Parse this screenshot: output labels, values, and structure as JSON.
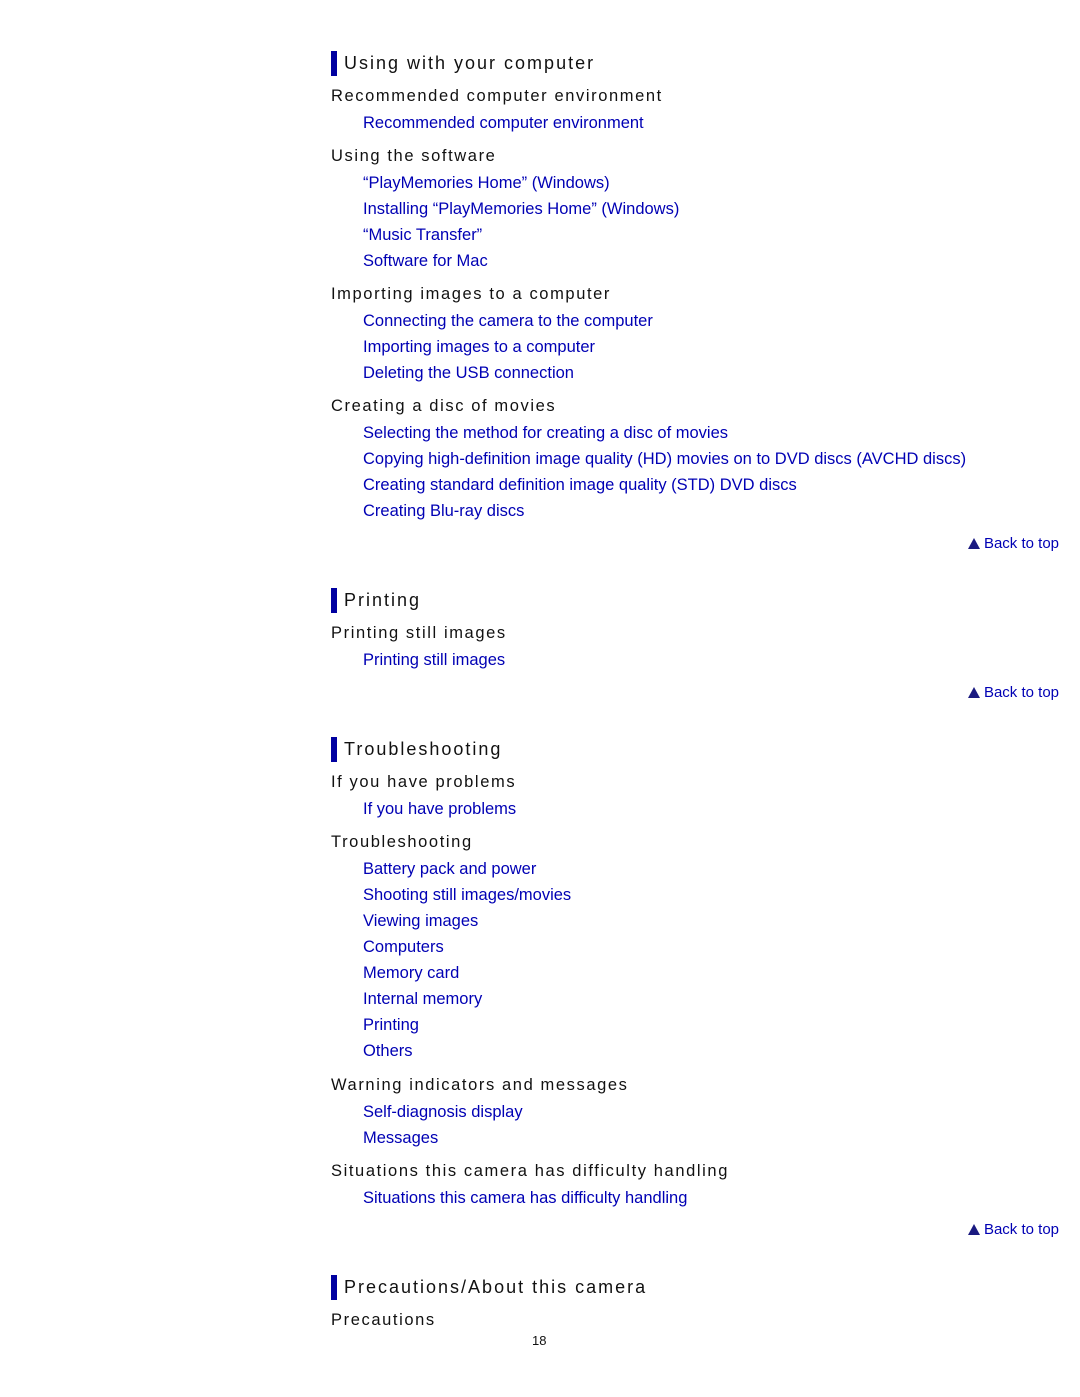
{
  "sections": [
    {
      "title": "Using with your computer",
      "groups": [
        {
          "heading": "Recommended computer environment",
          "links": [
            "Recommended computer environment"
          ]
        },
        {
          "heading": "Using the software",
          "links": [
            "“PlayMemories Home” (Windows)",
            "Installing “PlayMemories Home” (Windows)",
            "“Music Transfer”",
            "Software for Mac"
          ]
        },
        {
          "heading": "Importing images to a computer",
          "links": [
            "Connecting the camera to the computer",
            "Importing images to a computer",
            "Deleting the USB connection"
          ]
        },
        {
          "heading": "Creating a disc of movies",
          "links": [
            "Selecting the method for creating a disc of movies",
            "Copying high-definition image quality (HD) movies on to DVD discs (AVCHD discs)",
            "Creating standard definition image quality (STD) DVD discs",
            "Creating Blu-ray discs"
          ]
        }
      ],
      "back_to_top": "Back to top"
    },
    {
      "title": "Printing",
      "groups": [
        {
          "heading": "Printing still images",
          "links": [
            "Printing still images"
          ]
        }
      ],
      "back_to_top": "Back to top"
    },
    {
      "title": "Troubleshooting",
      "groups": [
        {
          "heading": "If you have problems",
          "links": [
            "If you have problems"
          ]
        },
        {
          "heading": "Troubleshooting",
          "links": [
            "Battery pack and power",
            "Shooting still images/movies",
            "Viewing images",
            "Computers",
            "Memory card",
            "Internal memory",
            "Printing",
            "Others"
          ]
        },
        {
          "heading": "Warning indicators and messages",
          "links": [
            "Self-diagnosis display",
            "Messages"
          ]
        },
        {
          "heading": "Situations this camera has difficulty handling",
          "links": [
            "Situations this camera has difficulty handling"
          ]
        }
      ],
      "back_to_top": "Back to top"
    },
    {
      "title": "Precautions/About this camera",
      "groups": [
        {
          "heading": "Precautions",
          "links": []
        }
      ]
    }
  ],
  "page_number": "18",
  "icons": {
    "back_to_top": "triangle-up-icon"
  },
  "colors": {
    "link": "#0000b4",
    "section_bar": "#0000a0",
    "text": "#111111"
  }
}
